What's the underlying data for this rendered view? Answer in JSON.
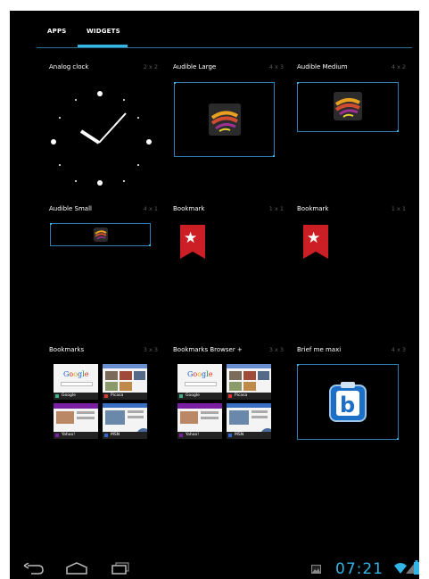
{
  "tabs": {
    "apps_label": "APPS",
    "widgets_label": "WIDGETS"
  },
  "widgets": [
    {
      "name": "Analog clock",
      "size": "2 x 2"
    },
    {
      "name": "Audible Large",
      "size": "4 x 3"
    },
    {
      "name": "Audible Medium",
      "size": "4 x 2"
    },
    {
      "name": "Audible Small",
      "size": "4 x 1"
    },
    {
      "name": "Bookmark",
      "size": "1 x 1"
    },
    {
      "name": "Bookmark",
      "size": "1 x 1"
    },
    {
      "name": "Bookmarks",
      "size": "3 x 3"
    },
    {
      "name": "Bookmarks Browser +",
      "size": "3 x 3"
    },
    {
      "name": "Brief me maxi",
      "size": "4 x 3"
    }
  ],
  "bookmark_thumbs": {
    "google": "Google",
    "picasa": "Picasa",
    "yahoo": "Yahoo!",
    "msn": "MSN"
  },
  "status": {
    "time": "07:21"
  },
  "colors": {
    "accent": "#33b5e5",
    "background": "#000000",
    "bookmark_red": "#cc1f25"
  },
  "icons": {
    "back": "back-icon",
    "home": "home-icon",
    "recents": "recent-apps-icon",
    "gallery": "gallery-notification-icon",
    "wifi": "wifi-icon",
    "signal": "signal-icon",
    "battery": "battery-icon"
  }
}
